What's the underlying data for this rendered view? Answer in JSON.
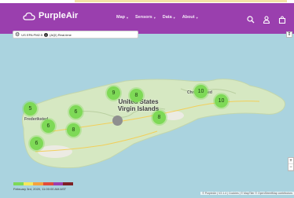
{
  "header": {
    "logo_text": "PurpleAir",
    "menu": [
      {
        "label": "Map"
      },
      {
        "label": "Sensors"
      },
      {
        "label": "Data"
      },
      {
        "label": "About"
      }
    ],
    "icons": [
      "search-icon",
      "user-icon",
      "bag-icon"
    ]
  },
  "toolbar": {
    "sensor_label": "US EPA PM2.5",
    "sensor_suffix": "(AQI) Real-time"
  },
  "map": {
    "places": {
      "country": "United States Virgin Islands",
      "town_east": "Christiansted",
      "town_west": "Frederiksted"
    },
    "markers": [
      {
        "value": "9"
      },
      {
        "value": "8"
      },
      {
        "value": "10"
      },
      {
        "value": "10"
      },
      {
        "value": "5"
      },
      {
        "value": "6"
      },
      {
        "value": "6"
      },
      {
        "value": "8"
      },
      {
        "value": "8"
      },
      {
        "value": "6"
      }
    ],
    "marker_color": "#7ed957",
    "legend_colors": [
      "#7ed957",
      "#f5e85c",
      "#f5a23c",
      "#e24b3a",
      "#9c3fae",
      "#7e2124"
    ],
    "timestamp": "February 3rd, 2020, 11:00:00 AM AST",
    "attribution": "© PurpleAir | V2.1.4 | Cookies | © MapTiler © OpenStreetMap contributors"
  }
}
